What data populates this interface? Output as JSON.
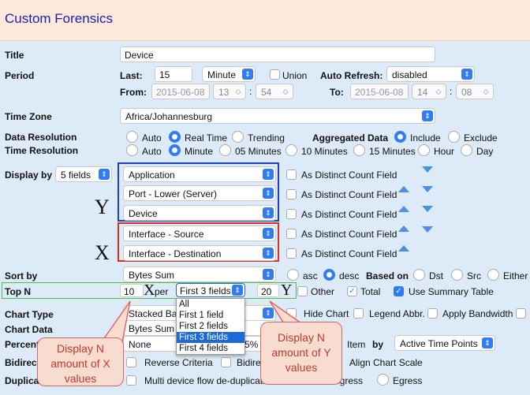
{
  "header": {
    "title": "Custom Forensics"
  },
  "labels": {
    "title": "Title",
    "period": "Period",
    "time_zone": "Time Zone",
    "data_resolution": "Data Resolution",
    "time_resolution": "Time Resolution",
    "display_by": "Display by",
    "sort_by": "Sort by",
    "top_n": "Top N",
    "chart_type": "Chart Type",
    "chart_data": "Chart Data",
    "percent": "Percent",
    "bidirec": "Bidirec",
    "duplica": "Duplica"
  },
  "title_value": "Device",
  "period": {
    "last_label": "Last:",
    "last_value": "15",
    "unit": "Minute",
    "union": "Union",
    "auto_refresh_label": "Auto Refresh:",
    "auto_refresh": "disabled",
    "from_label": "From:",
    "from_date": "2015-06-08",
    "from_h": "13",
    "from_m": "54",
    "to_label": "To:",
    "to_date": "2015-06-08",
    "to_h": "14",
    "to_m": "08",
    "sep": ":"
  },
  "time_zone": "Africa/Johannesburg",
  "data_resolution": {
    "auto": "Auto",
    "real_time": "Real Time",
    "trending": "Trending",
    "aggregated_label": "Aggregated Data",
    "include": "Include",
    "exclude": "Exclude"
  },
  "time_resolution": {
    "auto": "Auto",
    "minute": "Minute",
    "m05": "05 Minutes",
    "m10": "10 Minutes",
    "m15": "15 Minutes",
    "hour": "Hour",
    "day": "Day"
  },
  "display_by": {
    "fields": "5 fields",
    "items": [
      "Application",
      "Port - Lower (Server)",
      "Device",
      "Interface - Source",
      "Interface - Destination"
    ],
    "distinct": "As Distinct Count Field"
  },
  "sort_by": {
    "value": "Bytes Sum",
    "asc": "asc",
    "desc": "desc",
    "based_on": "Based on",
    "dst": "Dst",
    "src": "Src",
    "either": "Either"
  },
  "top_n": {
    "x": "10",
    "per": "per",
    "fields": "First 3 fields",
    "y": "20",
    "other": "Other",
    "total": "Total",
    "summary": "Use Summary Table"
  },
  "dropdown": {
    "options": [
      "All",
      "First 1 field",
      "First 2 fields",
      "First 3 fields",
      "First 4 fields"
    ],
    "selected": "First 3 fields"
  },
  "chart_type": {
    "value": "Stacked Bar",
    "hide": "Hide Chart",
    "legend": "Legend Abbr.",
    "apply": "Apply Bandwidth"
  },
  "chart_data": {
    "value": "Bytes Sum"
  },
  "percent": {
    "value": "None",
    "pct": "5%",
    "item": "Item",
    "by": "by",
    "by_value": "Active Time Points"
  },
  "bidirec": {
    "reverse": "Reverse Criteria",
    "bidire": "Bidirec",
    "align": "Align Chart Scale"
  },
  "duplica": {
    "multi": "Multi device flow de-duplicatio",
    "ingress": "ngress",
    "egress": "Egress"
  },
  "annotations": {
    "y": "Y",
    "x": "X",
    "callout_x": "Display N amount of X values",
    "callout_y": "Display N amount of Y values"
  },
  "colors": {
    "accent": "#2f7cf6",
    "blue_box": "#1a3fd1",
    "red_box": "#d9301f",
    "green_box": "#48c24a",
    "header_bg": "#fde9da",
    "page_bg": "#dcebf7"
  }
}
